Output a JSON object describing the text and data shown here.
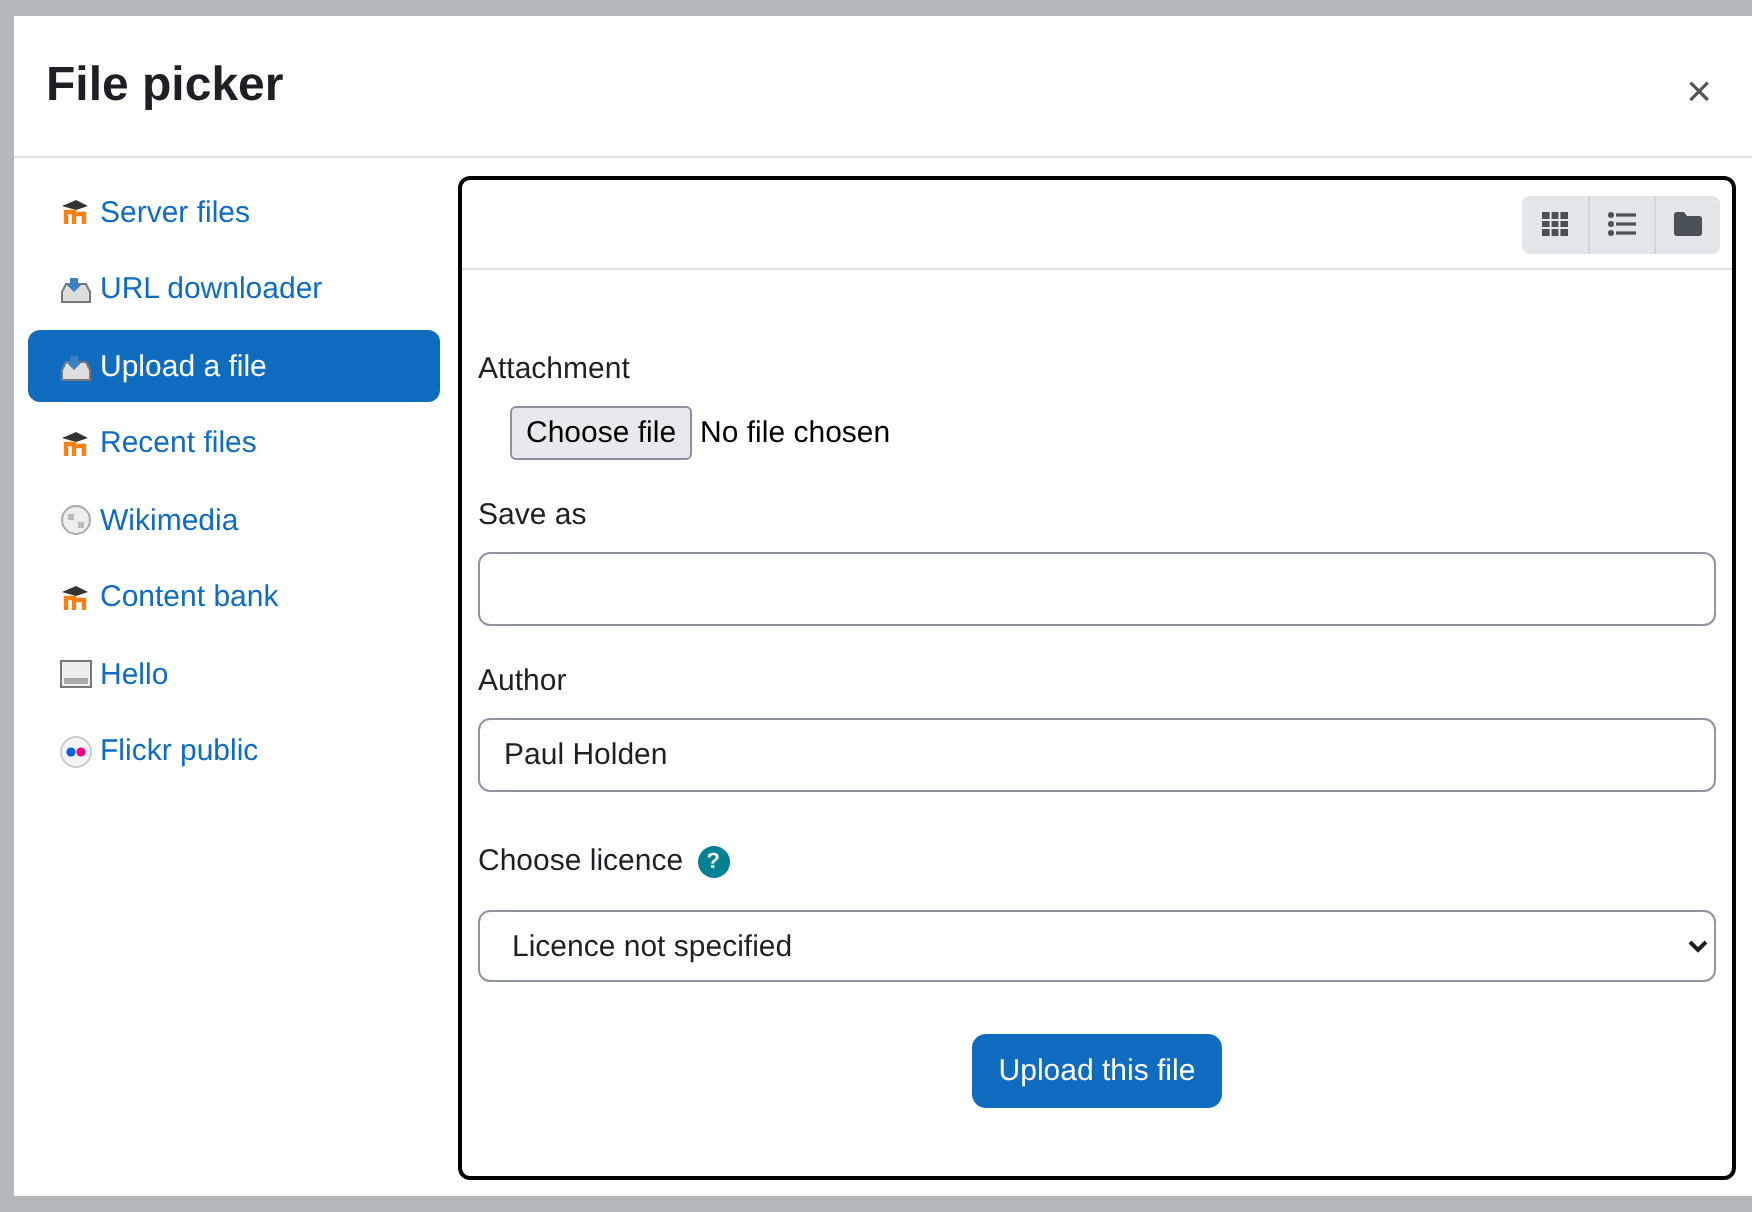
{
  "dialog": {
    "title": "File picker",
    "close": "×"
  },
  "sidebar": {
    "items": [
      {
        "label": "Server files",
        "kind": "moodle",
        "selected": false
      },
      {
        "label": "URL downloader",
        "kind": "download",
        "selected": false
      },
      {
        "label": "Upload a file",
        "kind": "download",
        "selected": true
      },
      {
        "label": "Recent files",
        "kind": "moodle",
        "selected": false
      },
      {
        "label": "Wikimedia",
        "kind": "globe",
        "selected": false
      },
      {
        "label": "Content bank",
        "kind": "moodle",
        "selected": false
      },
      {
        "label": "Hello",
        "kind": "box",
        "selected": false
      },
      {
        "label": "Flickr public",
        "kind": "flickr",
        "selected": false
      }
    ]
  },
  "view_buttons": [
    {
      "kind": "grid",
      "selected": false
    },
    {
      "kind": "list",
      "selected": false
    },
    {
      "kind": "tree",
      "selected": false
    }
  ],
  "form": {
    "attachment": {
      "label": "Attachment",
      "button": "Choose file",
      "status": "No file chosen"
    },
    "save_as": {
      "label": "Save as"
    },
    "author": {
      "label": "Author",
      "value": "Paul Holden"
    },
    "licence": {
      "label": "Choose licence",
      "help": "?",
      "value": "Licence not specified"
    },
    "submit": "Upload this file"
  }
}
